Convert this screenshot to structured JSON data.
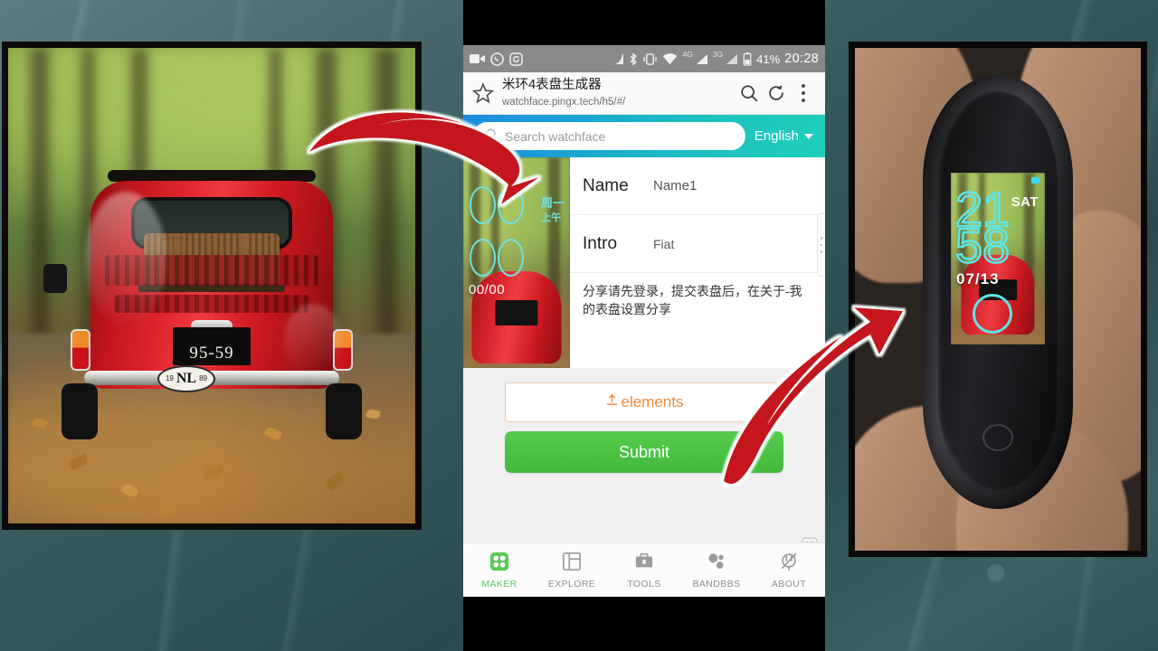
{
  "status_bar": {
    "icons_left": [
      "video-camera-icon",
      "whatsapp-icon",
      "screen-record-icon"
    ],
    "icons_right": [
      "cast-icon",
      "bluetooth-icon",
      "vibrate-icon",
      "wifi-icon",
      "signal-4g-icon",
      "signal-3g-icon",
      "battery-icon"
    ],
    "net_4g": "4G",
    "net_3g": "3G",
    "battery": "41%",
    "time": "20:28"
  },
  "browser": {
    "page_title": "米环4表盘生成器",
    "url": "watchface.pingx.tech/h5/#/",
    "star_icon": "bookmark-star-icon",
    "search_icon": "search-icon",
    "reload_icon": "reload-icon",
    "menu_icon": "overflow-menu-icon"
  },
  "app_header": {
    "search_placeholder": "Search watchface",
    "search_icon": "search-icon",
    "language": "English",
    "caret_icon": "chevron-down-icon"
  },
  "form": {
    "name_label": "Name",
    "name_value": "Name1",
    "intro_label": "Intro",
    "intro_value": "Fiat",
    "note": "分享请先登录，提交表盘后，在关于-我的表盘设置分享",
    "elements_button": "elements",
    "elements_icon": "upload-icon",
    "submit_button": "Submit",
    "drag_handle_icon": "drag-handle-icon",
    "mascot_icon": "robot-mascot-icon"
  },
  "thumbnail_watchface": {
    "hour": "00",
    "minute": "00",
    "weekday": "周一",
    "ampm": "上午",
    "date": "00/00"
  },
  "device_watchface": {
    "hour": "21",
    "minute": "58",
    "weekday": "SAT",
    "date": "07/13"
  },
  "tabbar": {
    "items": [
      {
        "label": "MAKER",
        "icon": "maker-icon",
        "active": true
      },
      {
        "label": "EXPLORE",
        "icon": "explore-icon",
        "active": false
      },
      {
        "label": "TOOLS",
        "icon": "toolbox-icon",
        "active": false
      },
      {
        "label": "BANDBBS",
        "icon": "bandbbs-icon",
        "active": false
      },
      {
        "label": "ABOUT",
        "icon": "plug-icon",
        "active": false
      }
    ]
  },
  "tab_switcher": {
    "new_tab_icon": "plus-icon",
    "grid_icon": "grid-icon",
    "expand_icon": "chevron-down-icon"
  },
  "photo_left": {
    "subject": "classic red Fiat 500 rear view on autumn forest road",
    "license_plate": "95-59",
    "country_badge": "NL",
    "badge_year_left": "19",
    "badge_year_right": "89"
  },
  "photo_right": {
    "subject": "Mi Band 4 held in fingers showing custom photo watchface"
  },
  "colors": {
    "header_gradient_start": "#1e8ae0",
    "header_gradient_end": "#20cfb8",
    "submit_green": "#4cc245",
    "elements_orange": "#f08a3c",
    "active_tab_green": "#5bc95a",
    "watchface_cyan": "#5fe6e8",
    "arrow_red": "#c4161c",
    "statusbar_grey": "#898989"
  }
}
